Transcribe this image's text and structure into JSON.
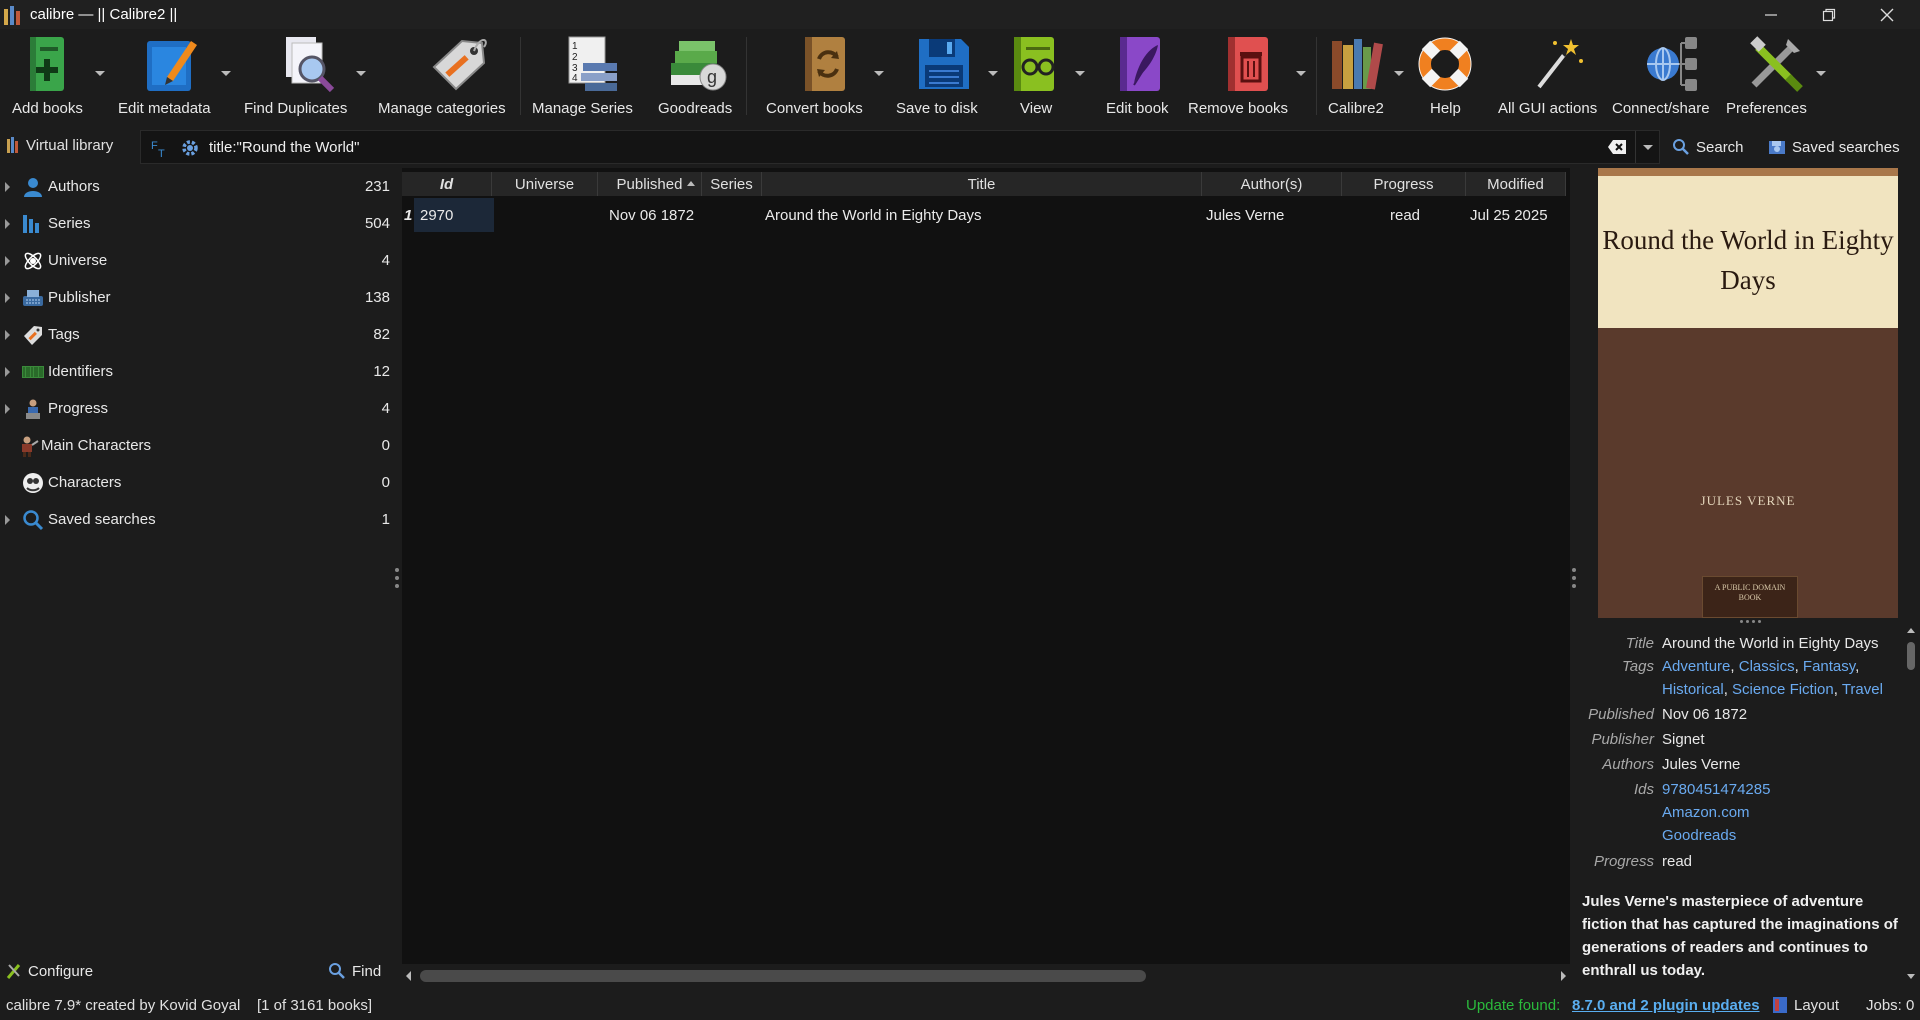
{
  "window": {
    "title": "calibre — || Calibre2 ||"
  },
  "toolbar": {
    "buttons": [
      {
        "label": "Add books",
        "icon": "add-book-icon"
      },
      {
        "label": "Edit metadata",
        "icon": "edit-metadata-icon"
      },
      {
        "label": "Find Duplicates",
        "icon": "find-duplicates-icon"
      },
      {
        "label": "Manage categories",
        "icon": "tag-icon"
      },
      {
        "label": "Manage Series",
        "icon": "series-list-icon"
      },
      {
        "label": "Goodreads",
        "icon": "goodreads-icon"
      },
      {
        "label": "Convert books",
        "icon": "convert-icon"
      },
      {
        "label": "Save to disk",
        "icon": "floppy-disk-icon"
      },
      {
        "label": "View",
        "icon": "view-book-icon"
      },
      {
        "label": "Edit book",
        "icon": "edit-book-icon"
      },
      {
        "label": "Remove books",
        "icon": "trash-icon"
      },
      {
        "label": "Calibre2",
        "icon": "library-icon"
      },
      {
        "label": "Help",
        "icon": "lifebuoy-icon"
      },
      {
        "label": "All GUI actions",
        "icon": "magic-wand-icon"
      },
      {
        "label": "Connect/share",
        "icon": "network-icon"
      },
      {
        "label": "Preferences",
        "icon": "tools-icon"
      }
    ]
  },
  "searchbar": {
    "virtual_library": "Virtual library",
    "query": "title:\"Round the World\"",
    "search_label": "Search",
    "saved_searches_label": "Saved searches"
  },
  "tag_browser": {
    "items": [
      {
        "name": "Authors",
        "count": "231",
        "expandable": true,
        "icon": "person-icon"
      },
      {
        "name": "Series",
        "count": "504",
        "expandable": true,
        "icon": "series-icon"
      },
      {
        "name": "Universe",
        "count": "4",
        "expandable": true,
        "icon": "universe-icon"
      },
      {
        "name": "Publisher",
        "count": "138",
        "expandable": true,
        "icon": "publisher-icon"
      },
      {
        "name": "Tags",
        "count": "82",
        "expandable": true,
        "icon": "tags-icon"
      },
      {
        "name": "Identifiers",
        "count": "12",
        "expandable": true,
        "icon": "barcode-icon"
      },
      {
        "name": "Progress",
        "count": "4",
        "expandable": true,
        "icon": "progress-icon"
      },
      {
        "name": "Main Characters",
        "count": "0",
        "expandable": false,
        "icon": "main-characters-icon"
      },
      {
        "name": "Characters",
        "count": "0",
        "expandable": false,
        "icon": "characters-icon"
      },
      {
        "name": "Saved searches",
        "count": "1",
        "expandable": true,
        "icon": "search-icon"
      }
    ],
    "configure_label": "Configure",
    "find_label": "Find"
  },
  "book_list": {
    "columns": [
      "Id",
      "Universe",
      "Published",
      "Series",
      "Title",
      "Author(s)",
      "Progress",
      "Modified"
    ],
    "rows": [
      {
        "row_number": "1",
        "id": "2970",
        "universe": "",
        "published": "Nov 06 1872",
        "series": "",
        "title": "Around the World in Eighty Days",
        "authors": "Jules Verne",
        "progress": "read",
        "modified": "Jul 25 2025"
      }
    ]
  },
  "details": {
    "cover_title": "Round the World in Eighty Days",
    "cover_author": "JULES VERNE",
    "cover_badge": "A PUBLIC DOMAIN BOOK",
    "title_label": "Title",
    "title": "Around the World in Eighty Days",
    "tags_label": "Tags",
    "tags": [
      "Adventure",
      "Classics",
      "Fantasy",
      "Historical",
      "Science Fiction",
      "Travel"
    ],
    "published_label": "Published",
    "published": "Nov 06 1872",
    "publisher_label": "Publisher",
    "publisher": "Signet",
    "authors_label": "Authors",
    "authors": "Jules Verne",
    "ids_label": "Ids",
    "ids": [
      "9780451474285",
      "Amazon.com",
      "Goodreads"
    ],
    "progress_label": "Progress",
    "progress": "read",
    "comment": "Jules Verne's masterpiece of adventure fiction that has captured the imaginations of generations of readers and continues to enthrall us today."
  },
  "status": {
    "left": "calibre 7.9* created by Kovid Goyal    [1 of 3161 books]",
    "update_found": "Update found:",
    "update_link": "8.7.0 and 2 plugin updates",
    "layout": "Layout",
    "jobs": "Jobs: 0"
  },
  "colors": {
    "background": "#1c1c1c",
    "link": "#6aaaf0",
    "update_green": "#2bba3c"
  }
}
